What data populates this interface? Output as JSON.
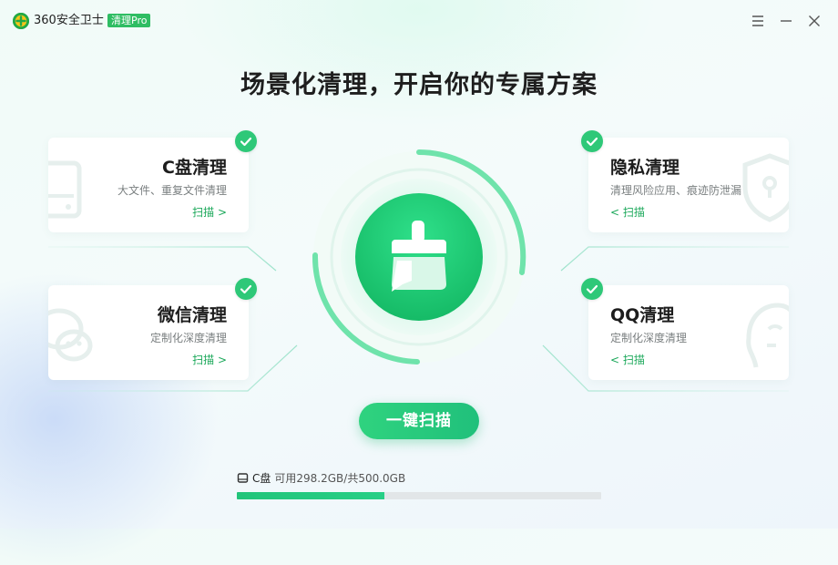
{
  "titlebar": {
    "app_name": "360安全卫士",
    "badge": "清理Pro"
  },
  "headline": "场景化清理，开启你的专属方案",
  "cards": [
    {
      "title": "C盘清理",
      "desc": "大文件、重复文件清理",
      "scan": "扫描 >",
      "checked": true,
      "icon": "hard-drive-icon"
    },
    {
      "title": "隐私清理",
      "desc": "清理风险应用、痕迹防泄漏",
      "scan": "< 扫描",
      "checked": true,
      "icon": "shield-lock-icon"
    },
    {
      "title": "微信清理",
      "desc": "定制化深度清理",
      "scan": "扫描 >",
      "checked": true,
      "icon": "wechat-icon"
    },
    {
      "title": "QQ清理",
      "desc": "定制化深度清理",
      "scan": "< 扫描",
      "checked": true,
      "icon": "qq-face-icon"
    }
  ],
  "center": {
    "icon": "broom-icon"
  },
  "scan_button": "一键扫描",
  "disk": {
    "label": "C盘",
    "usage": "可用298.2GB/共500.0GB",
    "used_fraction": 0.404
  },
  "colors": {
    "accent": "#2ec878",
    "badge_bg": "#2fbd63",
    "link": "#1ba85a",
    "progress_track": "#e2e6e8"
  }
}
